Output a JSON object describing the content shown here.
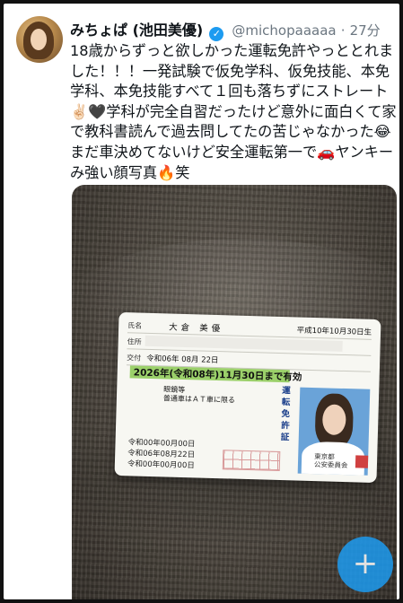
{
  "author": {
    "display_name": "みちょぱ (池田美優)",
    "handle": "@michopaaaaa",
    "separator": "·",
    "time": "27分"
  },
  "tweet": {
    "text": "18歳からずっと欲しかった運転免許やっととれました！！！一発試験で仮免学科、仮免技能、本免学科、本免技能すべて１回も落ちずにストレート✌🏻🖤学科が完全自習だったけど意外に面白くて家で教科書読んで過去問してたの苦じゃなかった😂まだ車決めてないけど安全運転第一で🚗ヤンキーみ強い顔写真🔥笑"
  },
  "license_card": {
    "name_label": "氏名",
    "name": "大倉 美優",
    "birth": "平成10年10月30日生",
    "address_label": "住所",
    "issue_label": "交付",
    "issue_date": "令和06年 08月 22日",
    "expiry": "2026年(令和08年)11月30日まで有効",
    "condition_label": "眼鏡等",
    "condition": "眼鏡等\n普通車はＡＴ車に限る",
    "class_label": "運転免許証",
    "history_1": "令和00年00月00日",
    "history_2": "令和06年08月22日",
    "history_3": "令和00年00月00日",
    "issuer": "東京都\n公安委員会"
  },
  "fab": {
    "icon": "compose-plus-icon",
    "symbol": "+"
  },
  "colors": {
    "accent": "#1d9bf0",
    "expiry_band": "#9bd06a"
  }
}
